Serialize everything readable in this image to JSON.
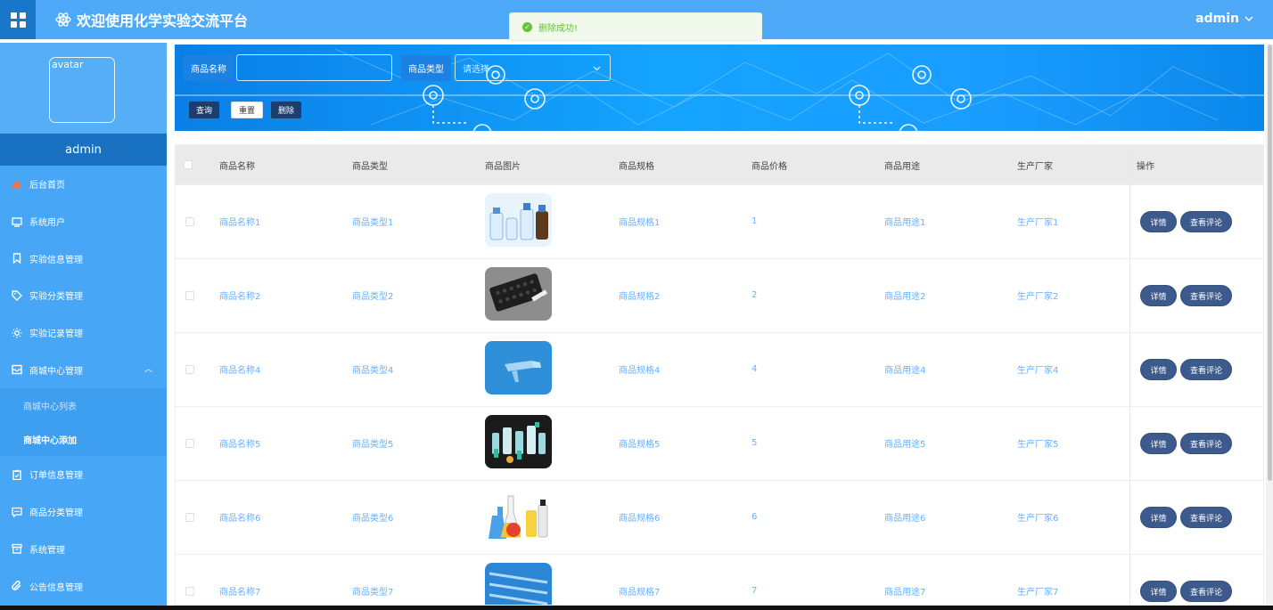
{
  "header": {
    "title": "欢迎使用化学实验交流平台",
    "user": "admin"
  },
  "toast": {
    "message": "删除成功!"
  },
  "profile": {
    "avatar_alt": "avatar",
    "name": "admin"
  },
  "sidebar": {
    "items": [
      {
        "label": "后台首页",
        "icon": "home-icon"
      },
      {
        "label": "系统用户",
        "icon": "monitor-icon"
      },
      {
        "label": "实验信息管理",
        "icon": "bookmark-icon"
      },
      {
        "label": "实验分类管理",
        "icon": "tag-icon"
      },
      {
        "label": "实验记录管理",
        "icon": "sun-icon"
      },
      {
        "label": "商城中心管理",
        "icon": "mail-icon",
        "expanded": true,
        "children": [
          {
            "label": "商城中心列表"
          },
          {
            "label": "商城中心添加",
            "active": true
          }
        ]
      },
      {
        "label": "订单信息管理",
        "icon": "clipboard-icon"
      },
      {
        "label": "商品分类管理",
        "icon": "message-icon"
      },
      {
        "label": "系统管理",
        "icon": "archive-icon"
      },
      {
        "label": "公告信息管理",
        "icon": "paperclip-icon"
      }
    ]
  },
  "search": {
    "name_label": "商品名称",
    "name_value": "",
    "type_label": "商品类型",
    "type_placeholder": "请选择",
    "query_button": "查询",
    "reset_button": "重置",
    "delete_button": "删除"
  },
  "table": {
    "columns": [
      "商品名称",
      "商品类型",
      "商品图片",
      "商品规格",
      "商品价格",
      "商品用途",
      "生产厂家",
      "操作"
    ],
    "rows": [
      {
        "name": "商品名称1",
        "type": "商品类型1",
        "image": "reagent-bottles",
        "spec": "商品规格1",
        "price": "1",
        "use": "商品用途1",
        "maker": "生产厂家1"
      },
      {
        "name": "商品名称2",
        "type": "商品类型2",
        "image": "tube-rack",
        "spec": "商品规格2",
        "price": "2",
        "use": "商品用途2",
        "maker": "生产厂家2"
      },
      {
        "name": "商品名称4",
        "type": "商品类型4",
        "image": "centrifuge-tube",
        "spec": "商品规格4",
        "price": "4",
        "use": "商品用途4",
        "maker": "生产厂家4"
      },
      {
        "name": "商品名称5",
        "type": "商品类型5",
        "image": "lab-plastics",
        "spec": "商品规格5",
        "price": "5",
        "use": "商品用途5",
        "maker": "生产厂家5"
      },
      {
        "name": "商品名称6",
        "type": "商品类型6",
        "image": "flasks",
        "spec": "商品规格6",
        "price": "6",
        "use": "商品用途6",
        "maker": "生产厂家6"
      },
      {
        "name": "商品名称7",
        "type": "商品类型7",
        "image": "test-tubes",
        "spec": "商品规格7",
        "price": "7",
        "use": "商品用途7",
        "maker": "生产厂家7"
      }
    ],
    "detail_button": "详情",
    "comments_button": "查看评论"
  },
  "colors": {
    "topbar": "#4eaaf8",
    "sidebar": "#47a6f5",
    "accent": "#1976c9",
    "link": "#66b1ff",
    "action_button": "#3d5a8c"
  }
}
